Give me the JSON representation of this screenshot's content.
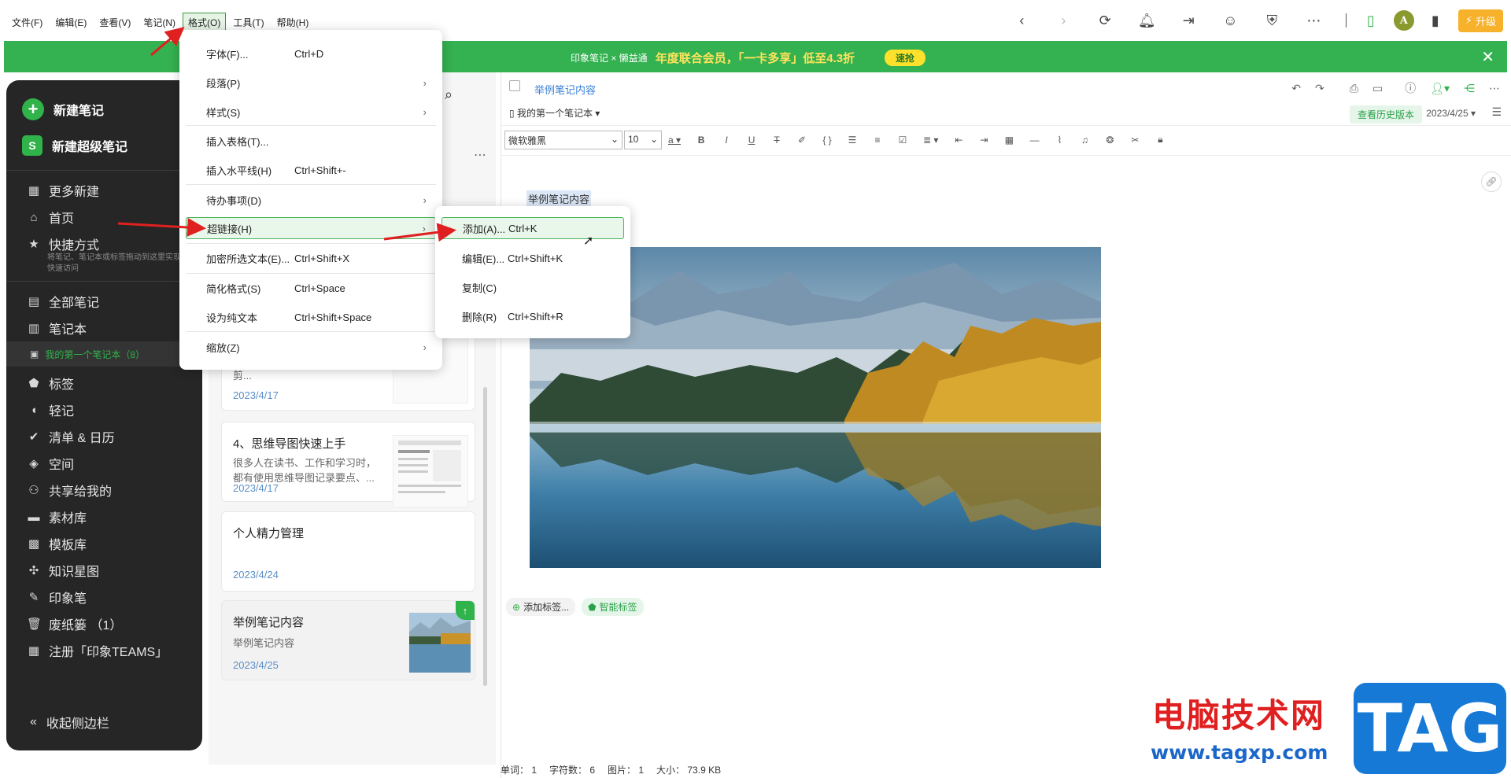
{
  "menubar": [
    "文件(F)",
    "编辑(E)",
    "查看(V)",
    "笔记(N)",
    "格式(O)",
    "工具(T)",
    "帮助(H)"
  ],
  "topbar": {
    "avatar": "A",
    "upgrade": "升级"
  },
  "banner": {
    "brand": "印象笔记 × 懒益通",
    "message": "年度联合会员，「一卡多享」低至4.3折",
    "button": "速抢"
  },
  "sidebar": {
    "new_note": "新建笔记",
    "new_super_note": "新建超级笔记",
    "items": [
      {
        "label": "更多新建",
        "icon": "grid-icon"
      },
      {
        "label": "首页",
        "icon": "home-icon"
      },
      {
        "label": "快捷方式",
        "icon": "star-icon"
      }
    ],
    "shortcut_hint": "将笔记、笔记本或标签拖动到这里实现快速访问",
    "items2": [
      {
        "label": "全部笔记",
        "icon": "note-icon"
      },
      {
        "label": "笔记本",
        "icon": "notebook-icon"
      }
    ],
    "notebook_sub": "我的第一个笔记本（8）",
    "items3": [
      {
        "label": "标签",
        "icon": "tag-icon"
      },
      {
        "label": "轻记",
        "icon": "feather-icon"
      },
      {
        "label": "清单 & 日历",
        "icon": "check-icon"
      },
      {
        "label": "空间",
        "icon": "cube-icon"
      },
      {
        "label": "共享给我的",
        "icon": "people-icon"
      },
      {
        "label": "素材库",
        "icon": "box-icon"
      },
      {
        "label": "模板库",
        "icon": "template-icon"
      },
      {
        "label": "知识星图",
        "icon": "graph-icon"
      },
      {
        "label": "印象笔",
        "icon": "pen-icon"
      },
      {
        "label": "废纸篓 （1）",
        "icon": "trash-icon"
      },
      {
        "label": "注册「印象TEAMS」",
        "icon": "building-icon"
      }
    ],
    "collapse": "收起侧边栏"
  },
  "notelist": {
    "cards": [
      {
        "title": "",
        "snippet": "...工具，利用印象笔记独家的剪...",
        "date": "2023/4/17"
      },
      {
        "title": "4、思维导图快速上手",
        "snippet": "很多人在读书、工作和学习时，都有使用思维导图记录要点、...",
        "date": "2023/4/17"
      },
      {
        "title": "个人精力管理",
        "snippet": "",
        "date": "2023/4/24"
      },
      {
        "title": "举例笔记内容",
        "snippet": "举例笔记内容",
        "date": "2023/4/25"
      }
    ]
  },
  "editor": {
    "title": "举例笔记内容",
    "notebook": "我的第一个笔记本",
    "history": "查看历史版本",
    "date": "2023/4/25",
    "font": "微软雅黑",
    "size": "10",
    "content_title": "举例笔记内容",
    "add_tag": "添加标签...",
    "smart_tag": "智能标签"
  },
  "status": {
    "words": "单词： 1",
    "chars": "字符数： 6",
    "images": "图片： 1",
    "size": "大小： 73.9 KB"
  },
  "format_menu": [
    {
      "label": "字体(F)...",
      "shortcut": "Ctrl+D",
      "arrow": ""
    },
    {
      "label": "段落(P)",
      "shortcut": "",
      "arrow": "›"
    },
    {
      "label": "样式(S)",
      "shortcut": "",
      "arrow": "›"
    },
    {
      "label": "插入表格(T)...",
      "shortcut": "",
      "arrow": ""
    },
    {
      "label": "插入水平线(H)",
      "shortcut": "Ctrl+Shift+-",
      "arrow": ""
    },
    {
      "label": "待办事项(D)",
      "shortcut": "",
      "arrow": "›"
    },
    {
      "label": "超链接(H)",
      "shortcut": "",
      "arrow": "›"
    },
    {
      "label": "加密所选文本(E)...",
      "shortcut": "Ctrl+Shift+X",
      "arrow": ""
    },
    {
      "label": "简化格式(S)",
      "shortcut": "Ctrl+Space",
      "arrow": ""
    },
    {
      "label": "设为纯文本",
      "shortcut": "Ctrl+Shift+Space",
      "arrow": ""
    },
    {
      "label": "缩放(Z)",
      "shortcut": "",
      "arrow": "›"
    }
  ],
  "link_submenu": [
    {
      "label": "添加(A)...",
      "shortcut": "Ctrl+K"
    },
    {
      "label": "编辑(E)...",
      "shortcut": "Ctrl+Shift+K"
    },
    {
      "label": "复制(C)",
      "shortcut": ""
    },
    {
      "label": "删除(R)",
      "shortcut": "Ctrl+Shift+R"
    }
  ],
  "watermark": {
    "text": "电脑技术网",
    "url": "www.tagxp.com",
    "logo": "TAG"
  }
}
